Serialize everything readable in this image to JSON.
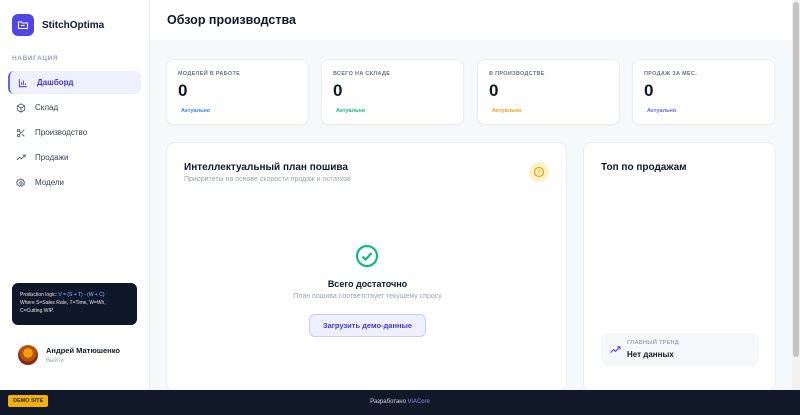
{
  "app": {
    "name": "StitchOptima"
  },
  "sidebar": {
    "heading": "НАВИГАЦИЯ",
    "items": [
      {
        "label": "Дашборд",
        "icon": "bar-chart-icon",
        "active": true
      },
      {
        "label": "Склад",
        "icon": "box-icon",
        "active": false
      },
      {
        "label": "Производство",
        "icon": "scissors-icon",
        "active": false
      },
      {
        "label": "Продажи",
        "icon": "trending-up-icon",
        "active": false
      },
      {
        "label": "Модели",
        "icon": "gear-icon",
        "active": false
      }
    ],
    "logic": {
      "prefix": "Production logic: ",
      "formula": "V = (S + T) - (W + C)",
      "line2": "Where S=Sales Rate, T=Time, W=Wh,",
      "line3": "C=Cutting WIP."
    },
    "user": {
      "name": "Андрей Матюшенко",
      "logout": "Выйти"
    }
  },
  "header": {
    "title": "Обзор производства"
  },
  "stats": [
    {
      "label": "МОДЕЛЕЙ В РАБОТЕ",
      "value": "0",
      "status": "Актуально",
      "color": "#3b82f6"
    },
    {
      "label": "ВСЕГО НА СКЛАДЕ",
      "value": "0",
      "status": "Актуально",
      "color": "#10b981"
    },
    {
      "label": "В ПРОИЗВОДСТВЕ",
      "value": "0",
      "status": "Актуально",
      "color": "#f59e0b"
    },
    {
      "label": "ПРОДАЖ ЗА МЕС.",
      "value": "0",
      "status": "Актуально",
      "color": "#6366f1"
    }
  ],
  "plan": {
    "title": "Интеллектуальный план пошива",
    "subtitle": "Приоритеты на основе скорости продаж и остатков",
    "empty_title": "Всего достаточно",
    "empty_subtitle": "План пошива соответствует текущему спросу",
    "button": "Загрузить демо-данные"
  },
  "top_sales": {
    "title": "Топ по продажам",
    "trend_label": "ГЛАВНЫЙ ТРЕНД",
    "trend_value": "Нет данных"
  },
  "footer": {
    "badge": "DEMO SITE",
    "credit_prefix": "Разработано",
    "credit_link": "ViACore"
  },
  "colors": {
    "accent": "#4f46e5",
    "warning": "#f59e0b",
    "success": "#10b981"
  }
}
